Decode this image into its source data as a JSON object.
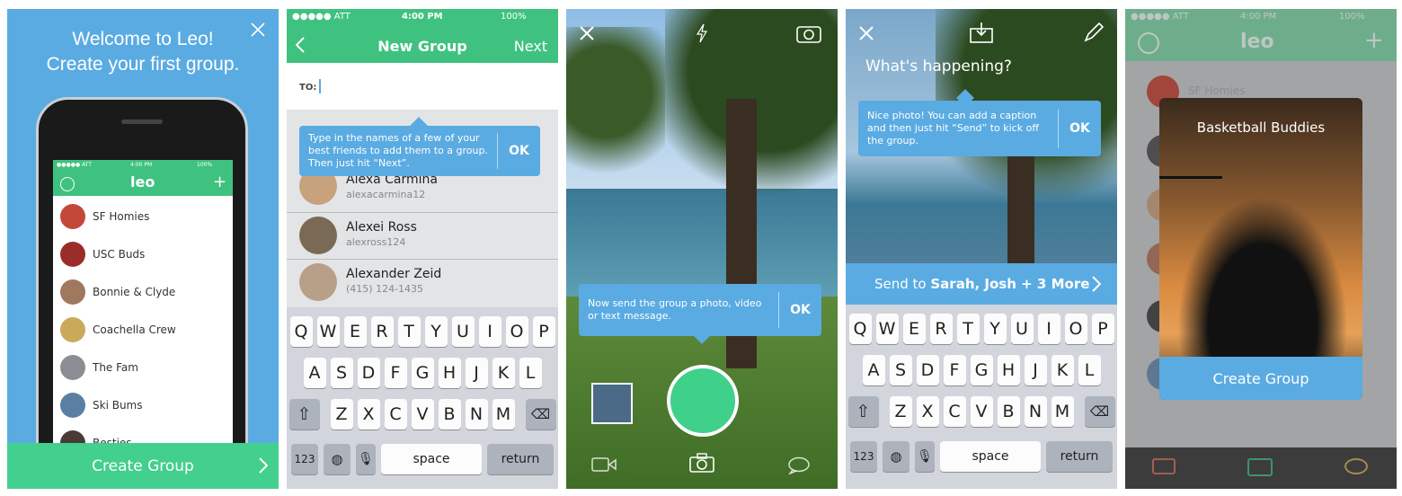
{
  "panel1": {
    "title_line1": "Welcome to Leo!",
    "title_line2": "Create your first group.",
    "phone": {
      "carrier": "●●●●● ATT",
      "time": "4:00 PM",
      "battery": "100%",
      "logo": "leo",
      "groups": [
        "SF Homies",
        "USC Buds",
        "Bonnie & Clyde",
        "Coachella Crew",
        "The Fam",
        "Ski Bums",
        "Besties"
      ]
    },
    "cta": "Create Group",
    "close_icon": "close-icon"
  },
  "panel2": {
    "status": {
      "carrier": "●●●●● ATT",
      "time": "4:00 PM",
      "battery": "100%"
    },
    "nav_title": "New Group",
    "nav_next": "Next",
    "to_label": "TO:",
    "tip_text": "Type in the names of a few of your best friends to add them to a group. Then just hit “Next”.",
    "tip_ok": "OK",
    "contacts": [
      {
        "name": "Alexa Carmina",
        "sub": "alexacarmina12"
      },
      {
        "name": "Alexei Ross",
        "sub": "alexross124"
      },
      {
        "name": "Alexander Zeid",
        "sub": "(415) 124-1435"
      }
    ]
  },
  "panel3": {
    "tip_text": "Now send the group a photo, video or text message.",
    "tip_ok": "OK"
  },
  "panel4": {
    "caption_placeholder": "What's happening?",
    "tip_text": "Nice photo! You can add a caption and then just hit “Send” to kick off the group.",
    "tip_ok": "OK",
    "send_prefix": "Send to ",
    "send_names": "Sarah, Josh + 3 More"
  },
  "keyboard": {
    "row1": [
      "Q",
      "W",
      "E",
      "R",
      "T",
      "Y",
      "U",
      "I",
      "O",
      "P"
    ],
    "row2": [
      "A",
      "S",
      "D",
      "F",
      "G",
      "H",
      "J",
      "K",
      "L"
    ],
    "row3": [
      "Z",
      "X",
      "C",
      "V",
      "B",
      "N",
      "M"
    ],
    "numbers": "123",
    "space": "space",
    "return": "return"
  },
  "panel5": {
    "status": {
      "carrier": "●●●●● ATT",
      "time": "4:00 PM",
      "battery": "100%"
    },
    "logo": "leo",
    "bg_group": "SF Homies",
    "card_title": "Basketball Buddies",
    "card_button": "Create Group"
  },
  "colors": {
    "brand_green": "#3fc27f",
    "tip_blue": "#5aabe2"
  }
}
